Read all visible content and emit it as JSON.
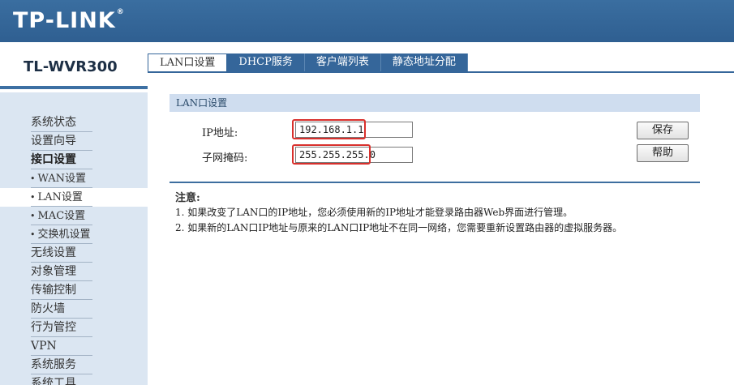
{
  "header": {
    "brand": "TP-LINK",
    "trademark": "®"
  },
  "device": {
    "model": "TL-WVR300"
  },
  "sidebar": {
    "items": [
      {
        "label": "系统状态",
        "type": "normal"
      },
      {
        "label": "设置向导",
        "type": "normal"
      },
      {
        "label": "接口设置",
        "type": "bold"
      },
      {
        "label": "WAN设置",
        "type": "sub"
      },
      {
        "label": "LAN设置",
        "type": "sub",
        "active": true
      },
      {
        "label": "MAC设置",
        "type": "sub"
      },
      {
        "label": "交换机设置",
        "type": "sub"
      },
      {
        "label": "无线设置",
        "type": "normal"
      },
      {
        "label": "对象管理",
        "type": "normal"
      },
      {
        "label": "传输控制",
        "type": "normal"
      },
      {
        "label": "防火墙",
        "type": "normal"
      },
      {
        "label": "行为管控",
        "type": "normal"
      },
      {
        "label": "VPN",
        "type": "normal"
      },
      {
        "label": "系统服务",
        "type": "normal"
      },
      {
        "label": "系统工具",
        "type": "normal"
      }
    ]
  },
  "tabs": [
    {
      "label": "LAN口设置",
      "active": true
    },
    {
      "label": "DHCP服务"
    },
    {
      "label": "客户端列表"
    },
    {
      "label": "静态地址分配"
    }
  ],
  "lan_section": {
    "title": "LAN口设置",
    "ip_label": "IP地址:",
    "ip_value": "192.168.1.1",
    "mask_label": "子网掩码:",
    "mask_value": "255.255.255.0"
  },
  "buttons": {
    "save": "保存",
    "help": "帮助"
  },
  "notes": {
    "title": "注意:",
    "lines": [
      "1. 如果改变了LAN口的IP地址，您必须使用新的IP地址才能登录路由器Web界面进行管理。",
      "2. 如果新的LAN口IP地址与原来的LAN口IP地址不在同一网络，您需要重新设置路由器的虚拟服务器。"
    ]
  },
  "colors": {
    "brand_blue": "#2f5f91",
    "highlight_red": "#d9302c",
    "section_bg": "#cfddef"
  }
}
